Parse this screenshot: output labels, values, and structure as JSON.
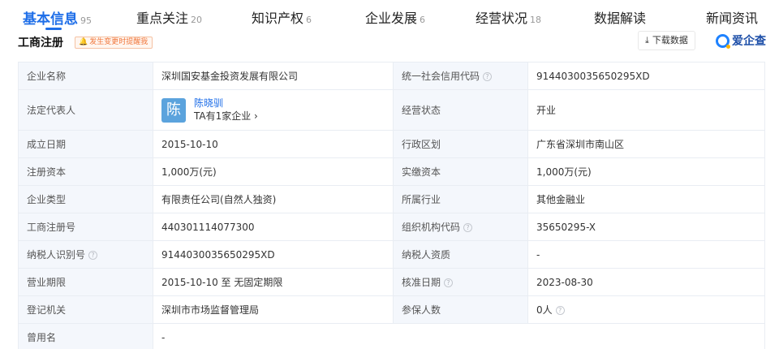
{
  "tabs": [
    {
      "label": "基本信息",
      "count": "95"
    },
    {
      "label": "重点关注",
      "count": "20"
    },
    {
      "label": "知识产权",
      "count": "6"
    },
    {
      "label": "企业发展",
      "count": "6"
    },
    {
      "label": "经营状况",
      "count": "18"
    },
    {
      "label": "数据解读",
      "count": ""
    },
    {
      "label": "新闻资讯",
      "count": ""
    }
  ],
  "section": {
    "title": "工商注册",
    "reminder": "发生变更时提醒我",
    "download": "下载数据",
    "brand": "爱企查"
  },
  "icons": {
    "help": "?",
    "bell": "bell-icon",
    "download": "download-icon"
  },
  "colors": {
    "accent": "#1e6ee8",
    "key_bg": "#f4f7fc",
    "reminder": "#f0773c"
  },
  "rows": [
    {
      "k1": "企业名称",
      "v1": "深圳国安基金投资发展有限公司",
      "k2": "统一社会信用代码",
      "v2": "9144030035650295XD"
    },
    {
      "k1": "法定代表人",
      "rep": {
        "avatar": "陈",
        "name": "陈晓驯",
        "sub": "TA有1家企业 ›"
      },
      "k2": "经营状态",
      "v2": "开业"
    },
    {
      "k1": "成立日期",
      "v1": "2015-10-10",
      "k2": "行政区划",
      "v2": "广东省深圳市南山区"
    },
    {
      "k1": "注册资本",
      "v1": "1,000万(元)",
      "k2": "实缴资本",
      "v2": "1,000万(元)"
    },
    {
      "k1": "企业类型",
      "v1": "有限责任公司(自然人独资)",
      "k2": "所属行业",
      "v2": "其他金融业"
    },
    {
      "k1": "工商注册号",
      "v1": "440301114077300",
      "k2": "组织机构代码",
      "v2": "35650295-X"
    },
    {
      "k1": "纳税人识别号",
      "v1": "9144030035650295XD",
      "k2": "纳税人资质",
      "v2": "-"
    },
    {
      "k1": "营业期限",
      "v1": "2015-10-10 至 无固定期限",
      "k2": "核准日期",
      "v2": "2023-08-30"
    },
    {
      "k1": "登记机关",
      "v1": "深圳市市场监督管理局",
      "k2": "参保人数",
      "v2": "0人"
    },
    {
      "k1": "曾用名",
      "v1": "-"
    }
  ]
}
